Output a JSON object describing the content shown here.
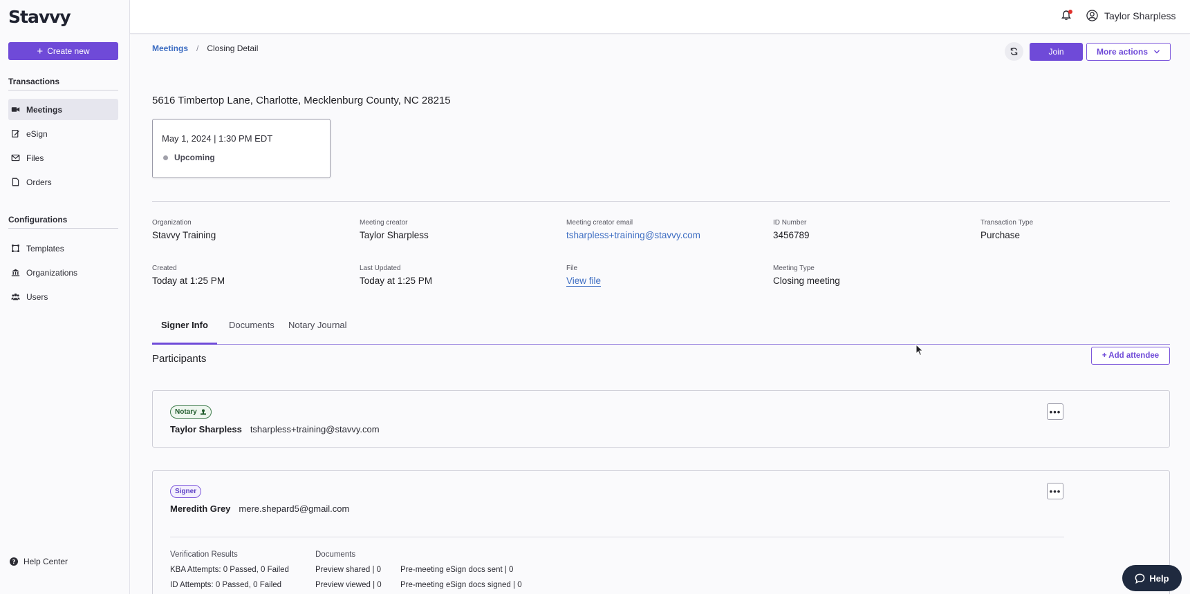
{
  "app": {
    "logo": "Stavvy"
  },
  "sidebar": {
    "create_label": "Create new",
    "transactions_title": "Transactions",
    "transactions": [
      {
        "label": "Meetings",
        "icon": "video-icon",
        "active": true
      },
      {
        "label": "eSign",
        "icon": "esign-icon"
      },
      {
        "label": "Files",
        "icon": "mail-icon"
      },
      {
        "label": "Orders",
        "icon": "document-icon"
      }
    ],
    "configurations_title": "Configurations",
    "configurations": [
      {
        "label": "Templates",
        "icon": "template-icon"
      },
      {
        "label": "Organizations",
        "icon": "bank-icon"
      },
      {
        "label": "Users",
        "icon": "users-icon"
      }
    ],
    "help_center": "Help Center"
  },
  "topbar": {
    "user_name": "Taylor Sharpless",
    "notification_color": "#e0312b"
  },
  "breadcrumb": {
    "parent": "Meetings",
    "separator": "/",
    "current": "Closing Detail"
  },
  "actions": {
    "join": "Join",
    "more": "More actions"
  },
  "meeting": {
    "address": "5616 Timbertop Lane, Charlotte, Mecklenburg County, NC 28215",
    "datetime": "May 1, 2024 | 1:30 PM EDT",
    "status": "Upcoming"
  },
  "details": {
    "organization_label": "Organization",
    "organization": "Stavvy Training",
    "creator_label": "Meeting creator",
    "creator": "Taylor Sharpless",
    "creator_email_label": "Meeting creator email",
    "creator_email": "tsharpless+training@stavvy.com",
    "id_label": "ID Number",
    "id": "3456789",
    "transaction_type_label": "Transaction Type",
    "transaction_type": "Purchase",
    "created_label": "Created",
    "created": "Today at 1:25 PM",
    "updated_label": "Last Updated",
    "updated": "Today at 1:25 PM",
    "file_label": "File",
    "file": "View file",
    "meeting_type_label": "Meeting Type",
    "meeting_type": "Closing meeting"
  },
  "tabs": [
    "Signer Info",
    "Documents",
    "Notary Journal"
  ],
  "participants": {
    "title": "Participants",
    "add_label": "+ Add attendee",
    "list": [
      {
        "role": "Notary",
        "name": "Taylor Sharpless",
        "email": "tsharpless+training@stavvy.com"
      },
      {
        "role": "Signer",
        "name": "Meredith Grey",
        "email": "mere.shepard5@gmail.com"
      }
    ],
    "verification": {
      "title": "Verification Results",
      "kba": "KBA Attempts: 0 Passed, 0 Failed",
      "id": "ID Attempts: 0 Passed, 0 Failed"
    },
    "documents": {
      "title": "Documents",
      "preview_shared": "Preview shared | 0",
      "preview_viewed": "Preview viewed | 0",
      "esign_sent": "Pre-meeting eSign docs sent | 0",
      "esign_signed": "Pre-meeting eSign docs signed | 0"
    }
  },
  "help_button": "Help",
  "colors": {
    "accent": "#6f4ad8",
    "link": "#3d6dc2",
    "help_bg": "#1f2a3f"
  }
}
